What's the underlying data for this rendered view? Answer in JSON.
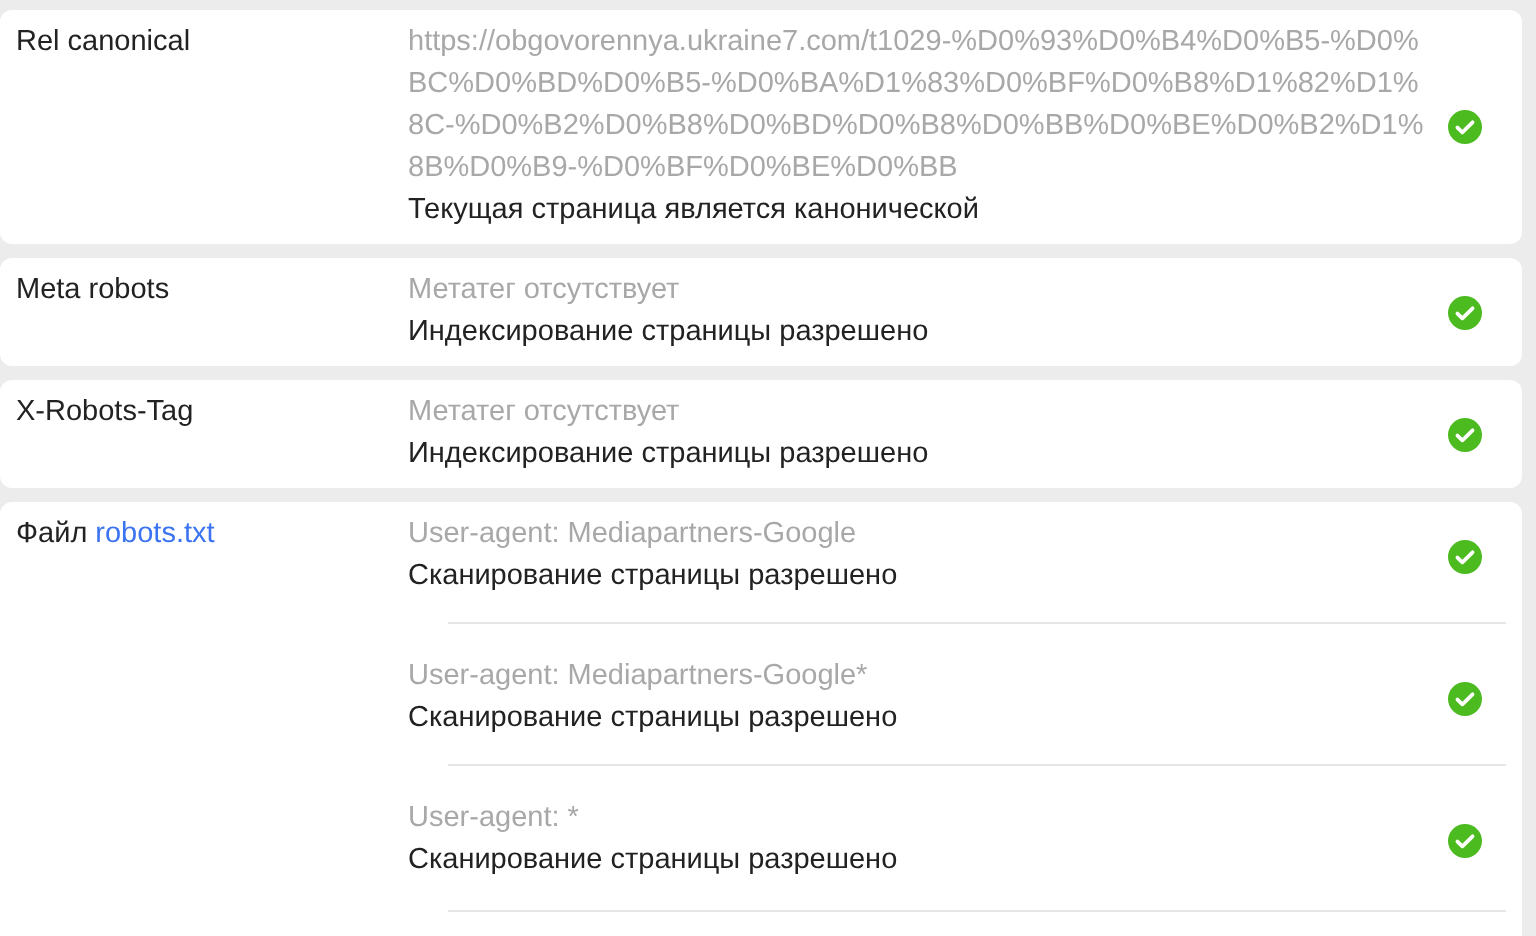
{
  "sections": [
    {
      "label": "Rel canonical",
      "entries": [
        {
          "detail": "https://obgovorennya.ukraine7.com/t1029-%D0%93%D0%B4%D0%B5-%D0%BC%D0%BD%D0%B5-%D0%BA%D1%83%D0%BF%D0%B8%D1%82%D1%8C-%D0%B2%D0%B8%D0%BD%D0%B8%D0%BB%D0%BE%D0%B2%D1%8B%D0%B9-%D0%BF%D0%BE%D0%BB",
          "result": "Текущая страница является канонической",
          "passed": true
        }
      ]
    },
    {
      "label": "Meta robots",
      "entries": [
        {
          "detail": "Метатег отсутствует",
          "result": "Индексирование страницы разрешено",
          "passed": true
        }
      ]
    },
    {
      "label": "X-Robots-Tag",
      "entries": [
        {
          "detail": "Метатег отсутствует",
          "result": "Индексирование страницы разрешено",
          "passed": true
        }
      ]
    },
    {
      "label": "Файл",
      "link": "robots.txt",
      "entries": [
        {
          "detail": "User-agent: Mediapartners-Google",
          "result": "Сканирование страницы разрешено",
          "passed": true
        },
        {
          "detail": "User-agent: Mediapartners-Google*",
          "result": "Сканирование страницы разрешено",
          "passed": true
        },
        {
          "detail": "User-agent: *",
          "result": "Сканирование страницы разрешено",
          "passed": true
        }
      ]
    }
  ]
}
